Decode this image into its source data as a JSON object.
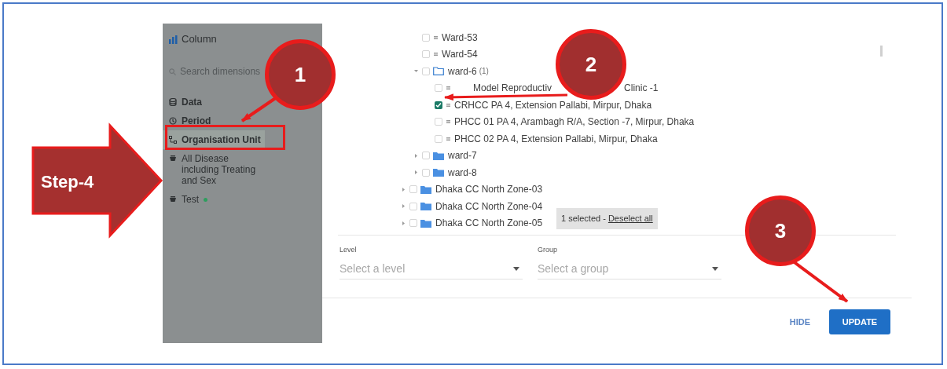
{
  "sidebar": {
    "chart_type": "Column",
    "search": {
      "placeholder": "Search dimensions"
    },
    "items": [
      {
        "kind": "data",
        "label": "Data",
        "selected": false,
        "indicator": false
      },
      {
        "kind": "period",
        "label": "Period",
        "selected": false,
        "indicator": false
      },
      {
        "kind": "orgunit",
        "label": "Organisation Unit",
        "selected": true,
        "indicator": false
      },
      {
        "kind": "dimension",
        "label": "All Disease including Treating and Sex",
        "selected": false,
        "indicator": false
      },
      {
        "kind": "dimension",
        "label": "Test",
        "selected": false,
        "indicator": true
      }
    ]
  },
  "tree": {
    "nested_items": [
      {
        "kind": "leaf",
        "label": "Ward-53",
        "checked": false
      },
      {
        "kind": "leaf",
        "label": "Ward-54",
        "checked": false
      },
      {
        "kind": "folder",
        "label": "ward-6",
        "count": "(1)",
        "checked": false,
        "expanded": true,
        "children": [
          {
            "kind": "leaf",
            "label_parts": [
              "Model Reproductiv",
              "Clinic -1"
            ],
            "checked": false
          },
          {
            "kind": "leaf",
            "label": "CRHCC PA 4, Extension Pallabi, Mirpur, Dhaka",
            "checked": true
          },
          {
            "kind": "leaf",
            "label": "PHCC 01 PA 4, Arambagh R/A, Section -7, Mirpur, Dhaka",
            "checked": false
          },
          {
            "kind": "leaf",
            "label": "PHCC 02 PA 4, Extension Pallabi, Mirpur, Dhaka",
            "checked": false
          }
        ]
      },
      {
        "kind": "folder",
        "label": "ward-7",
        "checked": false,
        "expanded": false
      },
      {
        "kind": "folder",
        "label": "ward-8",
        "checked": false,
        "expanded": false
      }
    ],
    "items": [
      {
        "kind": "folder",
        "label": "Dhaka CC North Zone-03",
        "checked": false,
        "expanded": false
      },
      {
        "kind": "folder",
        "label": "Dhaka CC North Zone-04",
        "checked": false,
        "expanded": false
      },
      {
        "kind": "folder",
        "label": "Dhaka CC North Zone-05",
        "checked": false,
        "expanded": false
      }
    ],
    "selection": {
      "count_text": "1 selected -",
      "action": "Deselect all"
    }
  },
  "level": {
    "label": "Level",
    "placeholder": "Select a level"
  },
  "group": {
    "label": "Group",
    "placeholder": "Select a group"
  },
  "buttons": {
    "hide": "HIDE",
    "update": "UPDATE"
  },
  "annotations": {
    "step_label": "Step-4",
    "markers": [
      "1",
      "2",
      "3"
    ]
  }
}
